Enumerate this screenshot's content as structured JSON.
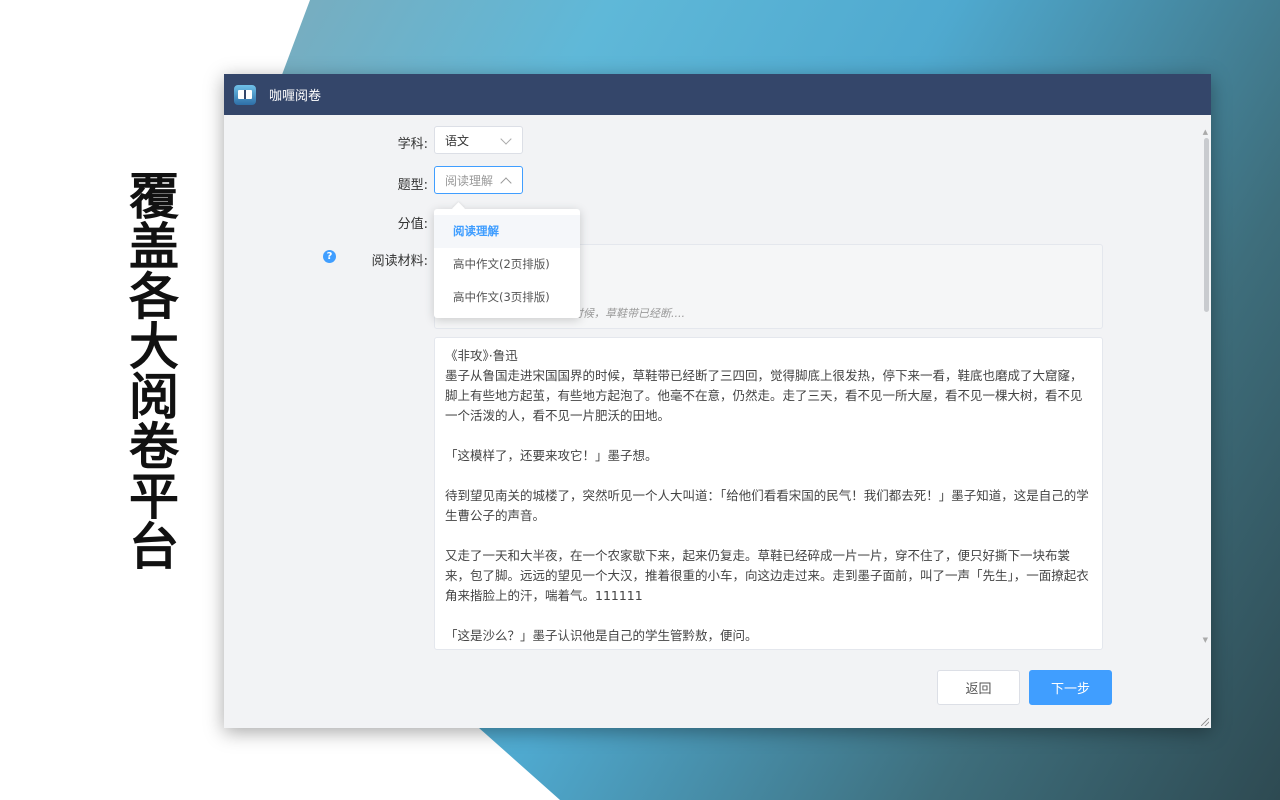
{
  "slogan": "覆盖各大阅卷平台",
  "window": {
    "title": "咖喱阅卷",
    "icon": "book-app-icon"
  },
  "form": {
    "subject_label": "学科:",
    "subject_value": "语文",
    "type_label": "题型:",
    "type_value": "阅读理解",
    "score_label": "分值:",
    "material_label": "阅读材料:",
    "help_icon": "?",
    "prompt_hint": "的时候，草鞋带已经断....",
    "type_options": [
      "阅读理解",
      "高中作文(2页排版)",
      "高中作文(3页排版)"
    ],
    "material_paragraphs": [
      "《非攻》·鲁迅",
      "墨子从鲁国走进宋国国界的时候，草鞋带已经断了三四回，觉得脚底上很发热，停下来一看，鞋底也磨成了大窟窿，脚上有些地方起茧，有些地方起泡了。他毫不在意，仍然走。走了三天，看不见一所大屋，看不见一棵大树，看不见一个活泼的人，看不见一片肥沃的田地。",
      "「这模样了，还要来攻它！」墨子想。",
      "待到望见南关的城楼了，突然听见一个人大叫道：「给他们看看宋国的民气！我们都去死！」墨子知道，这是自己的学生曹公子的声音。",
      "又走了一天和大半夜，在一个农家歇下来，起来仍复走。草鞋已经碎成一片一片，穿不住了，便只好撕下一块布裳来，包了脚。远远的望见一个大汉，推着很重的小车，向这边走过来。走到墨子面前，叫了一声「先生」，一面撩起衣角来揩脸上的汗，喘着气。111111",
      "「这是沙么？」墨子认识他是自己的学生管黔敖，便问。"
    ]
  },
  "buttons": {
    "back": "返回",
    "next": "下一步"
  },
  "colors": {
    "titlebar": "#34466a",
    "accent": "#409eff"
  }
}
